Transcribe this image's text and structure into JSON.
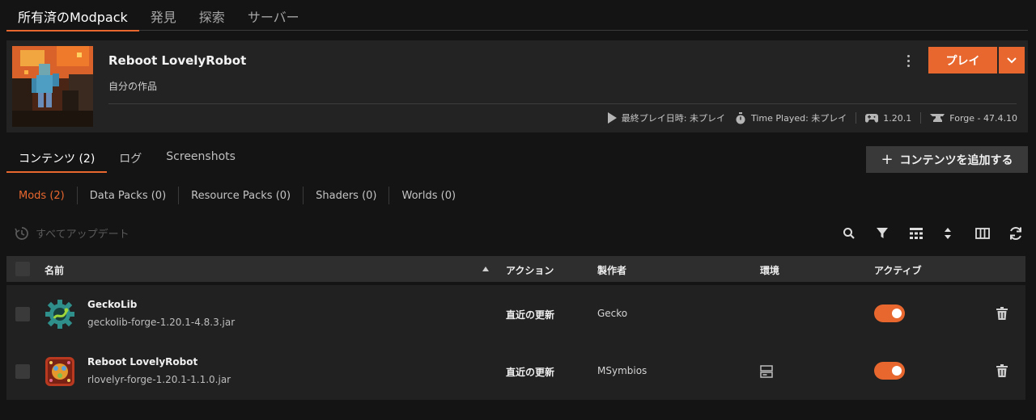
{
  "top_tabs": [
    {
      "label": "所有済のModpack",
      "active": true
    },
    {
      "label": "発見",
      "active": false
    },
    {
      "label": "探索",
      "active": false
    },
    {
      "label": "サーバー",
      "active": false
    }
  ],
  "modpack": {
    "title": "Reboot LovelyRobot",
    "subtitle": "自分の作品",
    "play_label": "プレイ",
    "last_played": "最終プレイ日時: 未プレイ",
    "time_played": "Time Played: 未プレイ",
    "game_version": "1.20.1",
    "loader": "Forge - 47.4.10"
  },
  "content_tabs": [
    {
      "label": "コンテンツ (2)",
      "active": true
    },
    {
      "label": "ログ",
      "active": false
    },
    {
      "label": "Screenshots",
      "active": false
    }
  ],
  "add_content_label": "コンテンツを追加する",
  "filters": [
    {
      "label": "Mods (2)",
      "active": true
    },
    {
      "label": "Data Packs (0)",
      "active": false
    },
    {
      "label": "Resource Packs (0)",
      "active": false
    },
    {
      "label": "Shaders (0)",
      "active": false
    },
    {
      "label": "Worlds (0)",
      "active": false
    }
  ],
  "update_all_label": "すべてアップデート",
  "table": {
    "columns": {
      "name": "名前",
      "action": "アクション",
      "author": "製作者",
      "environment": "環境",
      "active": "アクティブ"
    },
    "sort": "name-ascending",
    "rows": [
      {
        "name": "GeckoLib",
        "file": "geckolib-forge-1.20.1-4.8.3.jar",
        "action": "直近の更新",
        "author": "Gecko",
        "environment_icon": "",
        "active": true
      },
      {
        "name": "Reboot LovelyRobot",
        "file": "rlovelyr-forge-1.20.1-1.1.0.jar",
        "action": "直近の更新",
        "author": "MSymbios",
        "environment_icon": "server-icon",
        "active": true
      }
    ]
  },
  "colors": {
    "accent": "#e8672e",
    "background": "#141414",
    "card": "#232323"
  }
}
